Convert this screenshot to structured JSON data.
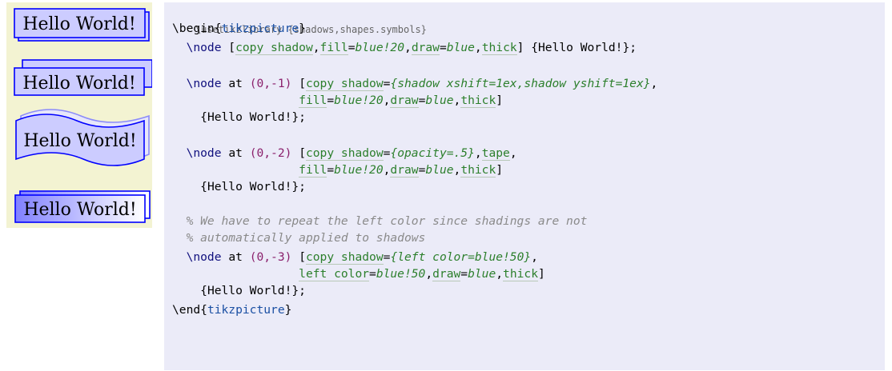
{
  "preview": {
    "node_text": "Hello World!",
    "colors": {
      "fill": "#ccccff",
      "draw": "#0000ff",
      "panel_bg": "#f3f3d2",
      "gradient_left": "#8080ff",
      "gradient_right": "#ffffff"
    },
    "nodes": [
      {
        "label": "Hello World!",
        "style": "copy-shadow"
      },
      {
        "label": "Hello World!",
        "style": "copy-shadow-shifted"
      },
      {
        "label": "Hello World!",
        "style": "tape-shadow-opacity"
      },
      {
        "label": "Hello World!",
        "style": "shaded-left-color"
      }
    ]
  },
  "code": {
    "line1": "\\usetikzlibrary {shadows,shapes.symbols}",
    "begin": "\\begin",
    "env": "tikzpicture",
    "end": "\\end",
    "node": "\\node",
    "at": "at",
    "copy_shadow": "copy shadow",
    "fill_key": "fill",
    "fill_val": "blue!20",
    "draw_key": "draw",
    "draw_val": "blue",
    "thick": "thick",
    "hello": "Hello World!",
    "coord1": "(0,-1)",
    "coord2": "(0,-2)",
    "coord3": "(0,-3)",
    "shadow1_val": "{shadow xshift=1ex,shadow yshift=1ex}",
    "shadow2_val": "{opacity=.5}",
    "tape": "tape",
    "shadow3_val": "{left color=blue!50}",
    "left_color_key": "left color",
    "left_color_val": "blue!50",
    "comment1": "% We have to repeat the left color since shadings are not",
    "comment2": "% automatically applied to shadows"
  }
}
